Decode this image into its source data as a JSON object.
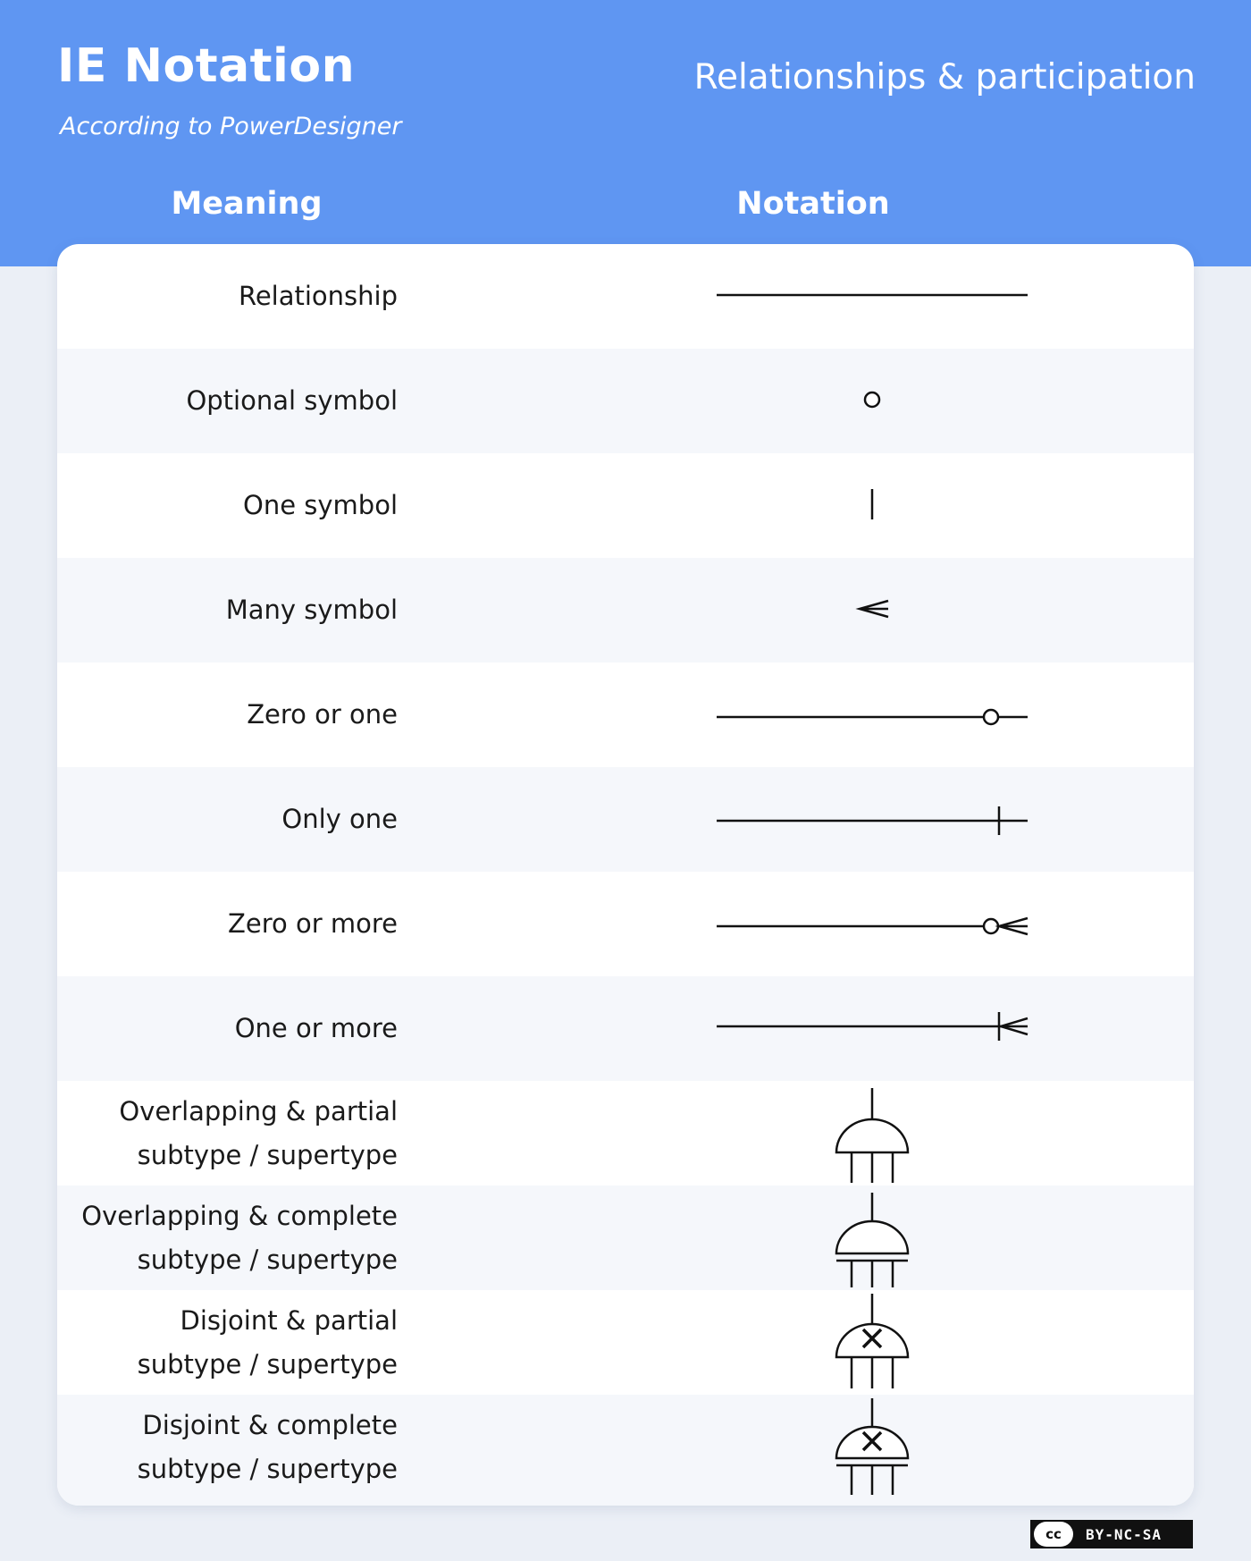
{
  "header": {
    "title": "IE Notation",
    "subtitle": "According to PowerDesigner",
    "topic": "Relationships & participation"
  },
  "columns": {
    "meaning": "Meaning",
    "notation": "Notation"
  },
  "rows": [
    {
      "lines": [
        "Relationship"
      ],
      "symbol": "line-icon"
    },
    {
      "lines": [
        "Optional symbol"
      ],
      "symbol": "circle-icon"
    },
    {
      "lines": [
        "One symbol"
      ],
      "symbol": "bar-icon"
    },
    {
      "lines": [
        "Many symbol"
      ],
      "symbol": "crows-foot-icon"
    },
    {
      "lines": [
        "Zero or one"
      ],
      "symbol": "zero-or-one-icon"
    },
    {
      "lines": [
        "Only one"
      ],
      "symbol": "only-one-icon"
    },
    {
      "lines": [
        "Zero or more"
      ],
      "symbol": "zero-or-more-icon"
    },
    {
      "lines": [
        "One or more"
      ],
      "symbol": "one-or-more-icon"
    },
    {
      "lines": [
        "Overlapping & partial",
        "subtype / supertype"
      ],
      "symbol": "overlapping-partial-icon"
    },
    {
      "lines": [
        "Overlapping & complete",
        "subtype / supertype"
      ],
      "symbol": "overlapping-complete-icon"
    },
    {
      "lines": [
        "Disjoint & partial",
        "subtype / supertype"
      ],
      "symbol": "disjoint-partial-icon"
    },
    {
      "lines": [
        "Disjoint & complete",
        "subtype / supertype"
      ],
      "symbol": "disjoint-complete-icon"
    }
  ],
  "license": {
    "cc": "cc",
    "text": "BY-NC-SA"
  }
}
